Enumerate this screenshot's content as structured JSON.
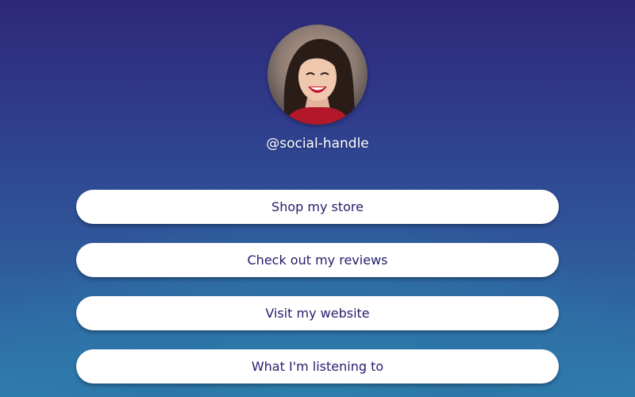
{
  "profile": {
    "handle": "@social-handle",
    "avatar_alt": "profile-photo"
  },
  "links": [
    {
      "label": "Shop my store"
    },
    {
      "label": "Check out my reviews"
    },
    {
      "label": "Visit my website"
    },
    {
      "label": "What I'm listening to"
    }
  ],
  "colors": {
    "background_top": "#2f2879",
    "background_bottom": "#2f7fae",
    "button_background": "#ffffff",
    "button_text": "#231d6b",
    "handle_text": "#ffffff"
  }
}
